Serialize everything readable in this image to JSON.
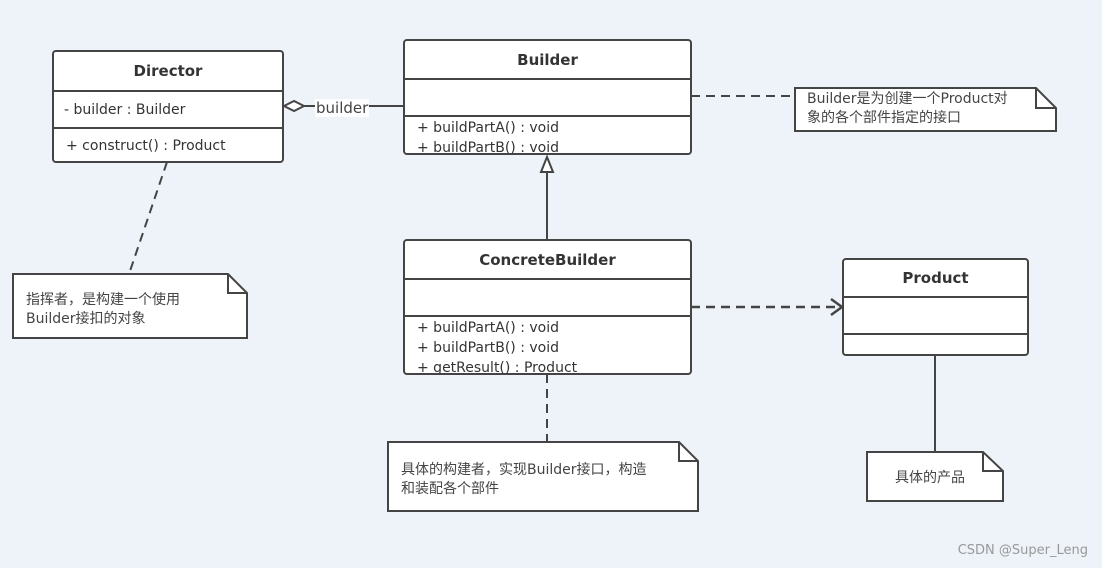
{
  "classes": {
    "director": {
      "name": "Director",
      "attributes": [
        "- builder : Builder"
      ],
      "operations": [
        "+ construct()  : Product"
      ]
    },
    "builder": {
      "name": "Builder",
      "attributes": [],
      "operations": [
        "+ buildPartA() : void",
        "+ buildPartB() : void"
      ]
    },
    "concrete_builder": {
      "name": "ConcreteBuilder",
      "attributes": [],
      "operations": [
        "+ buildPartA() : void",
        "+ buildPartB() : void",
        "+ getResult() : Product"
      ]
    },
    "product": {
      "name": "Product",
      "attributes": [],
      "operations": []
    }
  },
  "associations": {
    "director_builder_label": "builder"
  },
  "notes": {
    "director_note": [
      "指挥者，是构建一个使用",
      "Builder接扣的对象"
    ],
    "builder_note": [
      "Builder是为创建一个Product对",
      "象的各个部件指定的接口"
    ],
    "concrete_builder_note": [
      "具体的构建者，实现Builder接口，构造",
      "和装配各个部件"
    ],
    "product_note": [
      "具体的产品"
    ]
  },
  "colors": {
    "background": "#eef2f9",
    "stroke": "#444444",
    "fill": "#ffffff"
  },
  "watermark": "CSDN @Super_Leng"
}
